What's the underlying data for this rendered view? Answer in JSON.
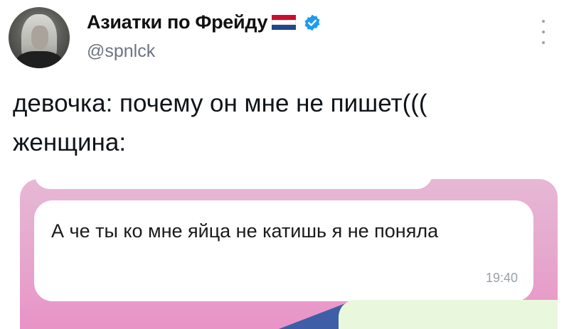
{
  "tweet": {
    "display_name": "Азиатки по Фрейду",
    "handle": "@spnlck",
    "text": "девочка: почему он мне не пишет(((\nженщина:",
    "flag_icon": "netherlands-flag-icon",
    "verified_icon": "verified-badge-icon",
    "more_icon": "vertical-dots-icon"
  },
  "chat": {
    "message_text": "А че ты ко мне яйца не катишь я не поняла",
    "message_time": "19:40"
  },
  "colors": {
    "verified": "#1d9bf0",
    "flag_red": "#c8102e",
    "flag_white": "#ffffff",
    "flag_blue": "#21468b",
    "chat_background": "#e6a8cd",
    "outgoing_bubble": "#e9f7dc"
  }
}
